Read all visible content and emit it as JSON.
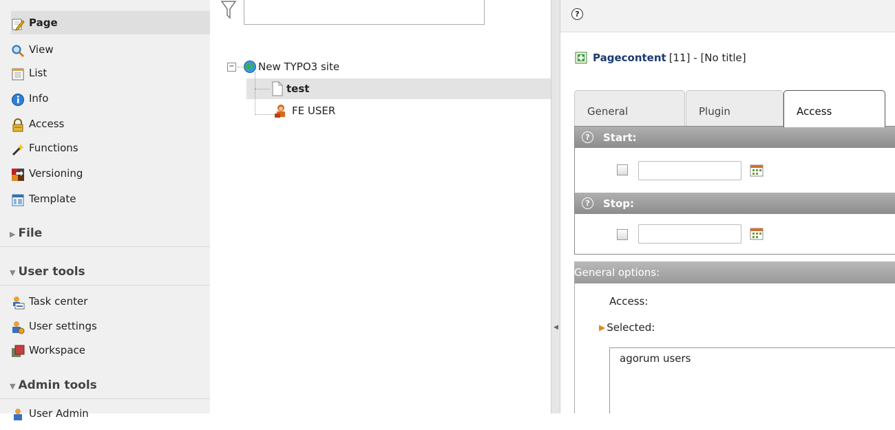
{
  "module_menu": {
    "web_items": [
      {
        "label": "Page",
        "icon": "page-edit-icon",
        "active": true
      },
      {
        "label": "View",
        "icon": "magnifier-icon"
      },
      {
        "label": "List",
        "icon": "list-icon"
      },
      {
        "label": "Info",
        "icon": "info-icon"
      },
      {
        "label": "Access",
        "icon": "padlock-icon"
      },
      {
        "label": "Functions",
        "icon": "wand-icon"
      },
      {
        "label": "Versioning",
        "icon": "versioning-icon"
      },
      {
        "label": "Template",
        "icon": "template-icon"
      }
    ],
    "groups": {
      "file": "File",
      "user_tools": "User tools",
      "admin_tools": "Admin tools"
    },
    "user_tools_items": [
      {
        "label": "Task center",
        "icon": "task-center-icon"
      },
      {
        "label": "User settings",
        "icon": "user-settings-icon"
      },
      {
        "label": "Workspace",
        "icon": "workspace-icon"
      }
    ],
    "admin_tools_items": [
      {
        "label": "User Admin",
        "icon": "user-admin-icon"
      }
    ]
  },
  "tree": {
    "filter_placeholder": "",
    "root": "New TYPO3 site",
    "children": [
      {
        "label": "test",
        "selected": true,
        "icon": "page-icon"
      },
      {
        "label": "FE USER",
        "selected": false,
        "icon": "fe-user-folder-icon"
      }
    ]
  },
  "record": {
    "title_bold": "Pagecontent",
    "title_rest": "[11] - [No title]"
  },
  "tabs": [
    {
      "label": "General",
      "active": false
    },
    {
      "label": "Plugin",
      "active": false
    },
    {
      "label": "Access",
      "active": true
    }
  ],
  "access_tab": {
    "start_label": "Start:",
    "start_value": "",
    "stop_label": "Stop:",
    "stop_value": ""
  },
  "general_options": {
    "header": "General options:",
    "access_label": "Access:",
    "selected_label": "Selected:",
    "selected_items": [
      "agorum users"
    ]
  },
  "colors": {
    "menu_bg": "#f0f0f0",
    "section_header": "#9c9c9c",
    "accent_orange": "#e08a1c"
  }
}
